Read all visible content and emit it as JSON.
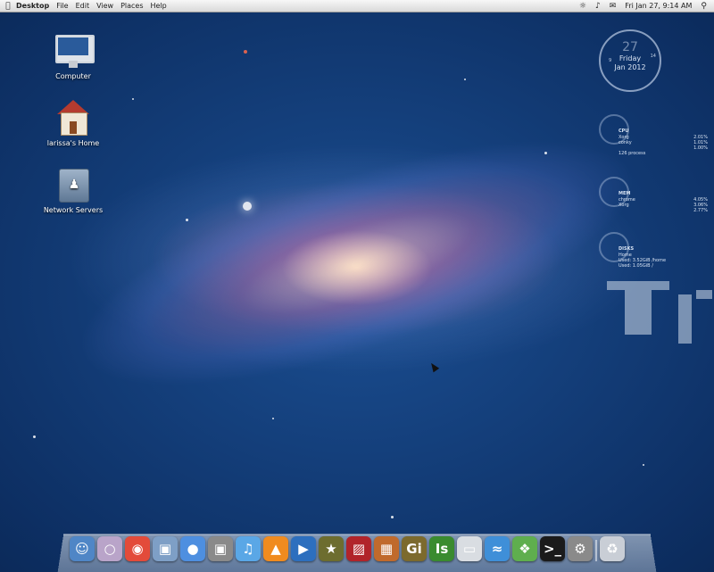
{
  "menubar": {
    "app": "Desktop",
    "items": [
      "File",
      "Edit",
      "View",
      "Places",
      "Help"
    ],
    "status": {
      "datetime": "Fri Jan 27,  9:14 AM",
      "wifi": "wifi-icon",
      "volume": "volume-icon",
      "mail": "mail-icon",
      "search": "search-icon"
    }
  },
  "desktop_icons": [
    {
      "label": "Computer",
      "icon": "computer-icon"
    },
    {
      "label": "larissa's Home",
      "icon": "home-folder-icon"
    },
    {
      "label": "Network Servers",
      "icon": "network-servers-icon"
    }
  ],
  "clock": {
    "day": "27",
    "weekday": "Friday",
    "date": "Jan 2012",
    "ticks": [
      "9",
      "14"
    ]
  },
  "sysmon": {
    "cpu": {
      "title": "CPU",
      "rows": [
        [
          "Xorg",
          "2.01%"
        ],
        [
          "conky",
          "1.01%"
        ],
        [
          "",
          "1.00%"
        ],
        [
          "126 process",
          ""
        ]
      ]
    },
    "mem": {
      "title": "MEM",
      "rows": [
        [
          "chrome",
          "4.05%"
        ],
        [
          "Xorg",
          "3.06%"
        ],
        [
          "",
          "2.77%"
        ]
      ]
    },
    "disks": {
      "title": "DISKS",
      "rows": [
        [
          "Home",
          ""
        ],
        [
          "Used: 3.52GiB /home",
          ""
        ],
        [
          "Used: 1.05GiB /",
          ""
        ]
      ]
    }
  },
  "dock": {
    "items": [
      {
        "name": "finder",
        "icon": "finder-icon",
        "color": "#4f86c6"
      },
      {
        "name": "gnome-do",
        "icon": "ring-icon",
        "color": "#b9a4c9"
      },
      {
        "name": "chrome",
        "icon": "chrome-icon",
        "color": "#e34b3a"
      },
      {
        "name": "preview",
        "icon": "preview-icon",
        "color": "#7e9fc6"
      },
      {
        "name": "messages",
        "icon": "chat-icon",
        "color": "#4e8fe0"
      },
      {
        "name": "photo-tool",
        "icon": "camera-icon",
        "color": "#8a8a8a"
      },
      {
        "name": "itunes",
        "icon": "music-icon",
        "color": "#5aa7e6"
      },
      {
        "name": "vlc",
        "icon": "vlc-icon",
        "color": "#f08b1f"
      },
      {
        "name": "media-player",
        "icon": "media-icon",
        "color": "#2d6fbe"
      },
      {
        "name": "imovie",
        "icon": "star-icon",
        "color": "#6d6d2f"
      },
      {
        "name": "photo-booth",
        "icon": "curtain-icon",
        "color": "#b1242a"
      },
      {
        "name": "iphoto",
        "icon": "photo-icon",
        "color": "#c06a2c"
      },
      {
        "name": "gimp",
        "icon": "gi-text-icon",
        "label": "Gi",
        "color": "#7c6a2d"
      },
      {
        "name": "illustrator",
        "icon": "is-text-icon",
        "label": "Is",
        "color": "#3a8b2f"
      },
      {
        "name": "drive",
        "icon": "drive-icon",
        "color": "#d9dde2"
      },
      {
        "name": "wifi-tool",
        "icon": "waves-icon",
        "color": "#3f8fd8"
      },
      {
        "name": "network",
        "icon": "network-icon",
        "color": "#5fae4e"
      },
      {
        "name": "terminal",
        "icon": "terminal-icon",
        "color": "#1b1b1b"
      },
      {
        "name": "system-prefs",
        "icon": "gear-icon",
        "color": "#8a8a8a"
      },
      {
        "name": "trash",
        "icon": "trash-icon",
        "color": "#c9ced6"
      }
    ]
  }
}
